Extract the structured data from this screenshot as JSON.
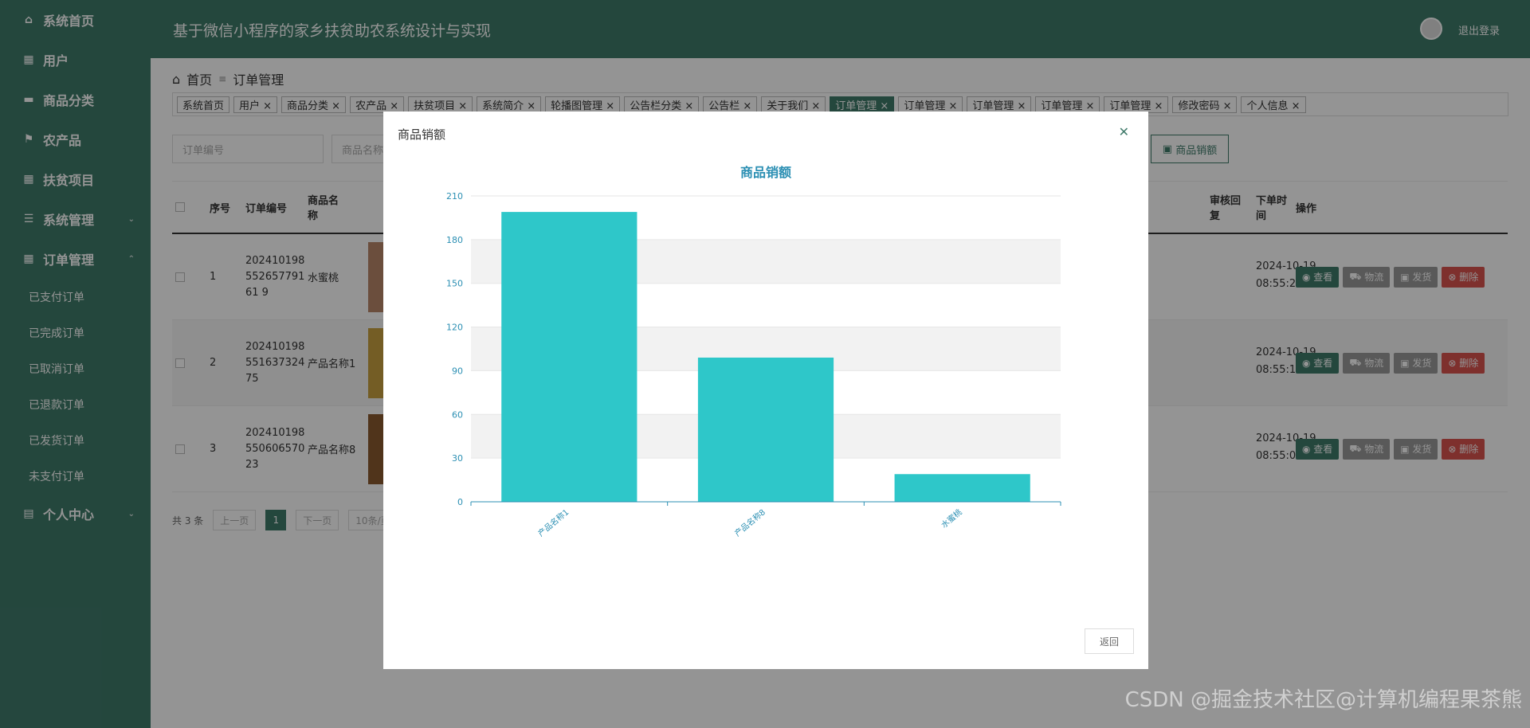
{
  "sidebar": {
    "items": [
      {
        "label": "系统首页",
        "icon": "home-icon"
      },
      {
        "label": "用户",
        "icon": "grid-icon"
      },
      {
        "label": "商品分类",
        "icon": "monitor-icon"
      },
      {
        "label": "农产品",
        "icon": "flag-icon"
      },
      {
        "label": "扶贫项目",
        "icon": "grid-icon"
      },
      {
        "label": "系统管理",
        "icon": "sliders-icon"
      },
      {
        "label": "订单管理",
        "icon": "grid-icon"
      }
    ],
    "order_sub": [
      "已支付订单",
      "已完成订单",
      "已取消订单",
      "已退款订单",
      "已发货订单",
      "未支付订单"
    ],
    "personal": "个人中心"
  },
  "header": {
    "title": "基于微信小程序的家乡扶贫助农系统设计与实现",
    "logout": "退出登录"
  },
  "breadcrumb": {
    "home": "首页",
    "current": "订单管理"
  },
  "tabs": [
    "系统首页",
    "用户 ×",
    "商品分类 ×",
    "农产品 ×",
    "扶贫项目 ×",
    "系统简介 ×",
    "轮播图管理 ×",
    "公告栏分类 ×",
    "公告栏 ×",
    "关于我们 ×",
    "订单管理 ×",
    "订单管理 ×",
    "订单管理 ×",
    "订单管理 ×",
    "订单管理 ×",
    "修改密码 ×",
    "个人信息 ×"
  ],
  "filters": {
    "order_no": "订单编号",
    "product_name": "商品名称"
  },
  "sales_button": "商品销额",
  "table": {
    "headers": {
      "idx": "序号",
      "order_no": "订单编号",
      "product_name": "商品名\n称",
      "audit": "审核回\n复",
      "time": "下单时\n间",
      "ops": "操作"
    },
    "rows": [
      {
        "idx": "1",
        "order_no": "20241019855265779161 9",
        "name": "水蜜桃",
        "date": "2024-10-19",
        "time": "08:55:27"
      },
      {
        "idx": "2",
        "order_no": "20241019855163732475",
        "name": "产品名称1",
        "date": "2024-10-19",
        "time": "08:55:16"
      },
      {
        "idx": "3",
        "order_no": "20241019855060657023",
        "name": "产品名称8",
        "date": "2024-10-19",
        "time": "08:55:01"
      }
    ],
    "ops": {
      "view": "查看",
      "logistics": "物流",
      "ship": "发货",
      "delete": "删除"
    }
  },
  "pager": {
    "total": "共 3 条",
    "prev": "上一页",
    "page": "1",
    "next": "下一页",
    "size": "10条/页"
  },
  "modal": {
    "title": "商品销额",
    "back": "返回"
  },
  "chart_data": {
    "type": "bar",
    "title": "商品销额",
    "categories": [
      "产品名称1",
      "产品名称8",
      "水蜜桃"
    ],
    "values": [
      199,
      99,
      19
    ],
    "ylim": [
      0,
      210
    ],
    "yticks": [
      0,
      30,
      60,
      90,
      120,
      150,
      180,
      210
    ],
    "color": "#2ec7c9",
    "grid": true
  },
  "watermark": "CSDN @掘金技术社区@计算机编程果茶熊"
}
